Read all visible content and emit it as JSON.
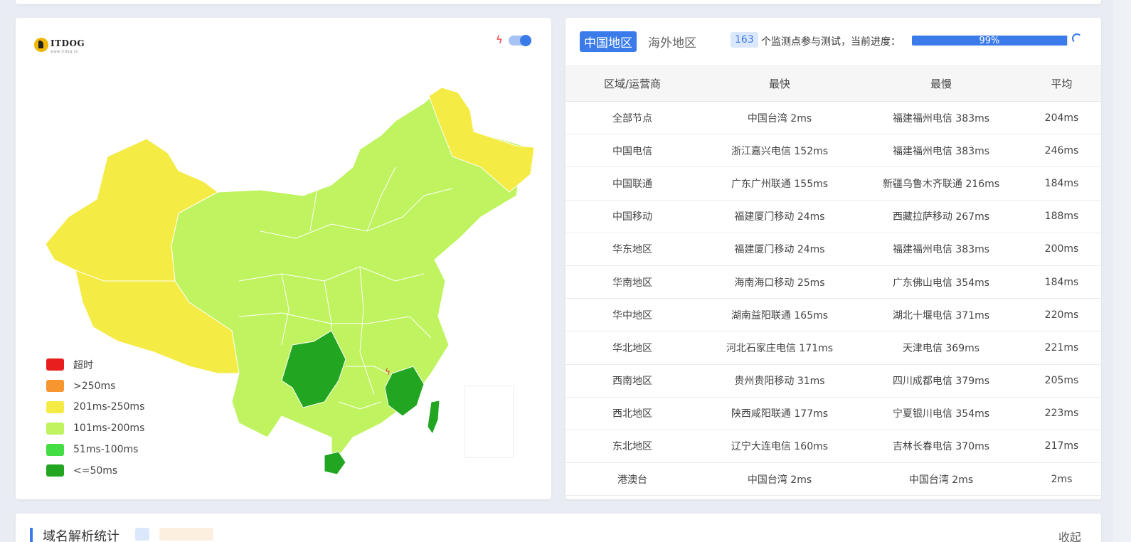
{
  "header": {
    "logo_text": "ITDOG",
    "logo_sub": "www.itdog.cn"
  },
  "map": {
    "toggle_on": true,
    "legend": [
      {
        "label": "超时",
        "color": "#e81d1d"
      },
      {
        "label": ">250ms",
        "color": "#f7952e"
      },
      {
        "label": "201ms-250ms",
        "color": "#f5eb45"
      },
      {
        "label": "101ms-200ms",
        "color": "#bff35f"
      },
      {
        "label": "51ms-100ms",
        "color": "#44dd44"
      },
      {
        "label": "<=50ms",
        "color": "#22a622"
      }
    ]
  },
  "tabs": [
    {
      "label": "中国地区",
      "active": true
    },
    {
      "label": "海外地区",
      "active": false
    }
  ],
  "status": {
    "count": "163",
    "text": "个监测点参与测试，当前进度：",
    "progress_label": "99%",
    "progress": 0.99
  },
  "table": {
    "headers": [
      "区域/运营商",
      "最快",
      "最慢",
      "平均"
    ],
    "rows": [
      [
        "全部节点",
        "中国台湾 2ms",
        "福建福州电信 383ms",
        "204ms"
      ],
      [
        "中国电信",
        "浙江嘉兴电信 152ms",
        "福建福州电信 383ms",
        "246ms"
      ],
      [
        "中国联通",
        "广东广州联通 155ms",
        "新疆乌鲁木齐联通 216ms",
        "184ms"
      ],
      [
        "中国移动",
        "福建厦门移动 24ms",
        "西藏拉萨移动 267ms",
        "188ms"
      ],
      [
        "华东地区",
        "福建厦门移动 24ms",
        "福建福州电信 383ms",
        "200ms"
      ],
      [
        "华南地区",
        "海南海口移动 25ms",
        "广东佛山电信 354ms",
        "184ms"
      ],
      [
        "华中地区",
        "湖南益阳联通 165ms",
        "湖北十堰电信 371ms",
        "220ms"
      ],
      [
        "华北地区",
        "河北石家庄电信 171ms",
        "天津电信 369ms",
        "221ms"
      ],
      [
        "西南地区",
        "贵州贵阳移动 31ms",
        "四川成都电信 379ms",
        "205ms"
      ],
      [
        "西北地区",
        "陕西咸阳联通 177ms",
        "宁夏银川电信 354ms",
        "223ms"
      ],
      [
        "东北地区",
        "辽宁大连电信 160ms",
        "吉林长春电信 370ms",
        "217ms"
      ],
      [
        "港澳台",
        "中国台湾 2ms",
        "中国台湾 2ms",
        "2ms"
      ]
    ]
  },
  "bottom": {
    "title": "域名解析统计",
    "collapse_label": "收起"
  }
}
